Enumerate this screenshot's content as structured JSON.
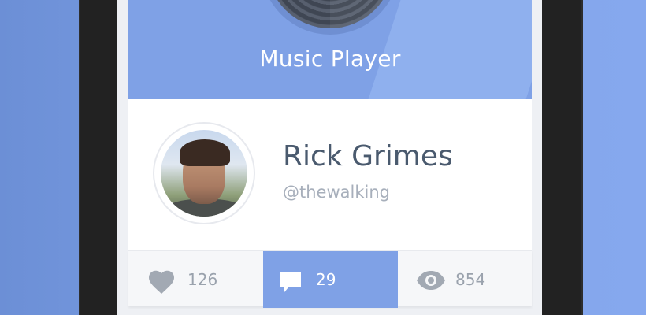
{
  "header": {
    "title": "Music Player"
  },
  "profile": {
    "name": "Rick Grimes",
    "handle": "@thewalking"
  },
  "stats": {
    "likes": "126",
    "comments": "29",
    "views": "854"
  },
  "colors": {
    "accent": "#7fa1e6",
    "name_text": "#4a5a6e",
    "muted_text": "#a7afbb",
    "stat_text": "#9aa2ad"
  },
  "icons": {
    "likes": "heart-icon",
    "comments": "comment-icon",
    "views": "eye-icon"
  }
}
